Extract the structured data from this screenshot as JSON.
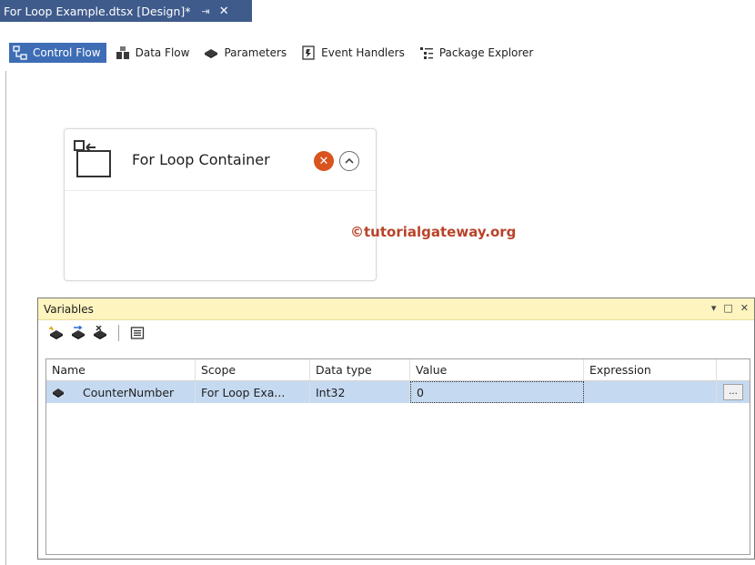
{
  "document": {
    "tab_title": "For Loop Example.dtsx [Design]*",
    "pin_glyph": "⇥",
    "close_glyph": "✕"
  },
  "designer_tabs": [
    {
      "label": "Control Flow",
      "icon": "control-flow-icon",
      "active": true
    },
    {
      "label": "Data Flow",
      "icon": "data-flow-icon",
      "active": false
    },
    {
      "label": "Parameters",
      "icon": "parameters-icon",
      "active": false
    },
    {
      "label": "Event Handlers",
      "icon": "event-handlers-icon",
      "active": false
    },
    {
      "label": "Package Explorer",
      "icon": "package-explorer-icon",
      "active": false
    }
  ],
  "container": {
    "title": "For Loop Container",
    "error_glyph": "✕"
  },
  "watermark": "©tutorialgateway.org",
  "variables_panel": {
    "title": "Variables",
    "controls": [
      "▾",
      "□",
      "✕"
    ],
    "columns": [
      "Name",
      "Scope",
      "Data type",
      "Value",
      "Expression"
    ],
    "rows": [
      {
        "name": "CounterNumber",
        "scope": "For Loop Exa...",
        "data_type": "Int32",
        "value": "0",
        "expression": "",
        "button": "..."
      }
    ]
  },
  "colors": {
    "tab_bg": "#3f5b8c",
    "active_designer_tab": "#3e6db5",
    "panel_title_bg": "#fdf4bf",
    "selected_row": "#c5d9f1",
    "error_icon": "#d9541e",
    "watermark": "#b8432a"
  }
}
